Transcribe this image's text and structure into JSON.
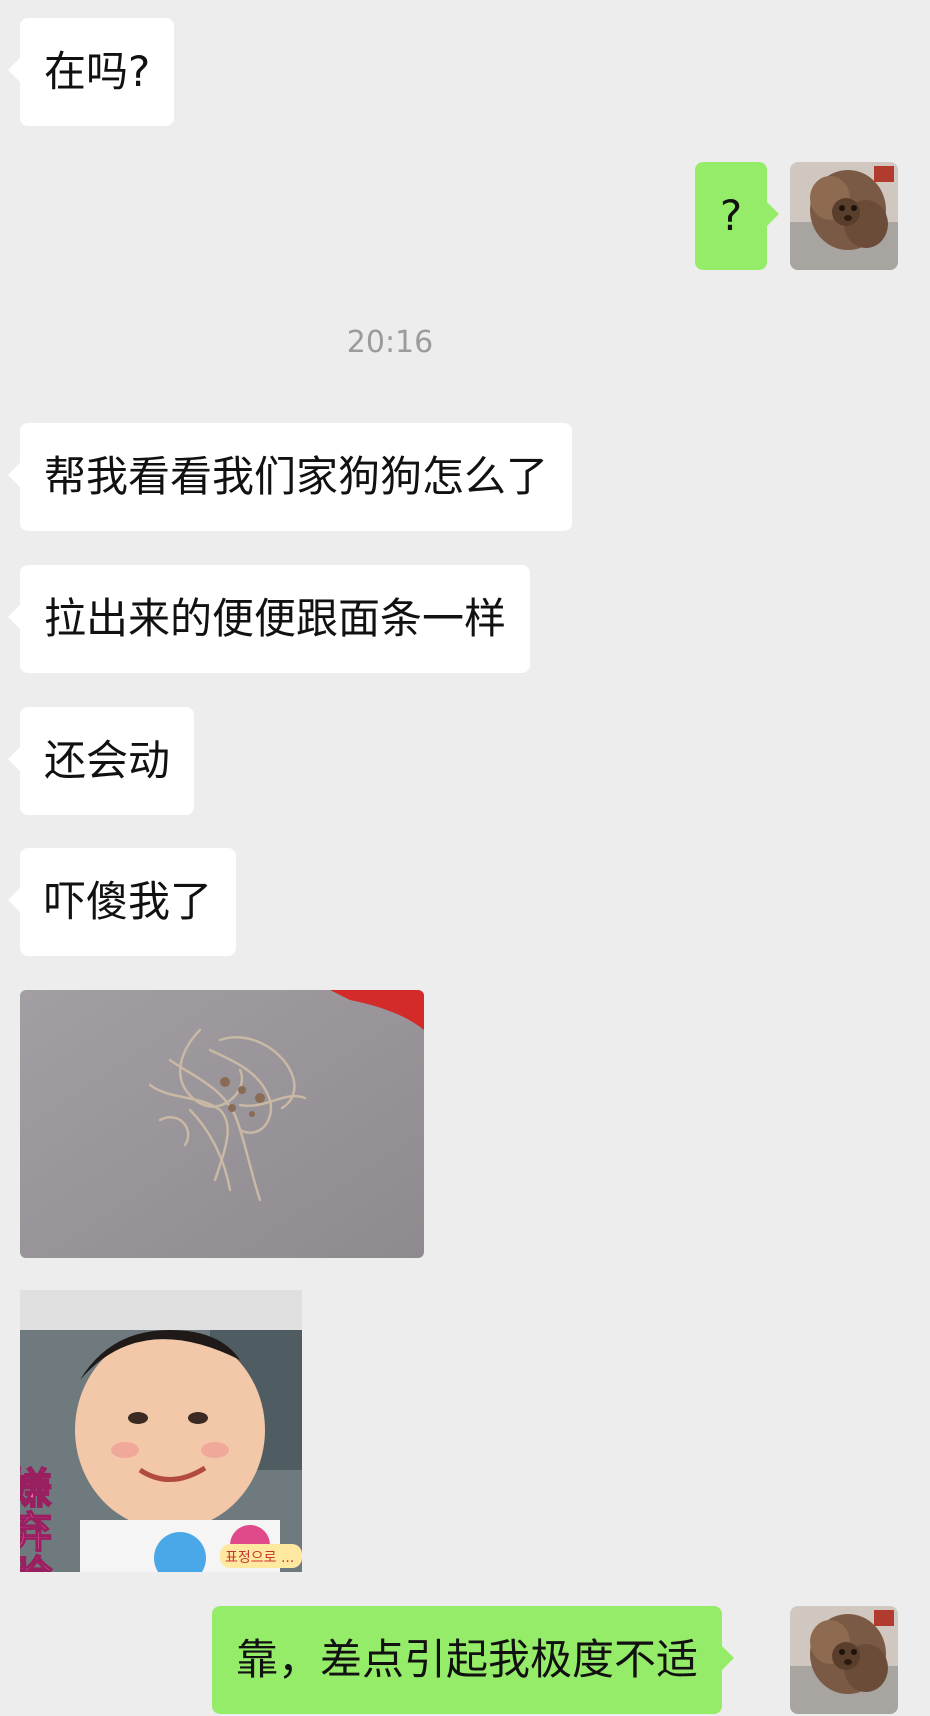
{
  "chat": {
    "timestamp": "20:16",
    "messages": [
      {
        "side": "left",
        "text": "在吗?"
      },
      {
        "side": "right",
        "text": "?"
      },
      {
        "side": "left",
        "text": "帮我看看我们家狗狗怎么了"
      },
      {
        "side": "left",
        "text": "拉出来的便便跟面条一样"
      },
      {
        "side": "left",
        "text": "还会动"
      },
      {
        "side": "left",
        "text": "吓傻我了"
      },
      {
        "side": "left",
        "type": "image",
        "icon": "photo-of-worms-on-floor"
      },
      {
        "side": "left",
        "type": "sticker",
        "icon": "baby-disgusted-face-sticker",
        "caption": "嫌弃脸",
        "subcaption": "표정으로 ..."
      },
      {
        "side": "right",
        "text": "靠，差点引起我极度不适"
      }
    ]
  },
  "colors": {
    "background": "#ededed",
    "incoming_bubble": "#ffffff",
    "outgoing_bubble": "#95ec69",
    "timestamp": "#9b9b9b"
  }
}
